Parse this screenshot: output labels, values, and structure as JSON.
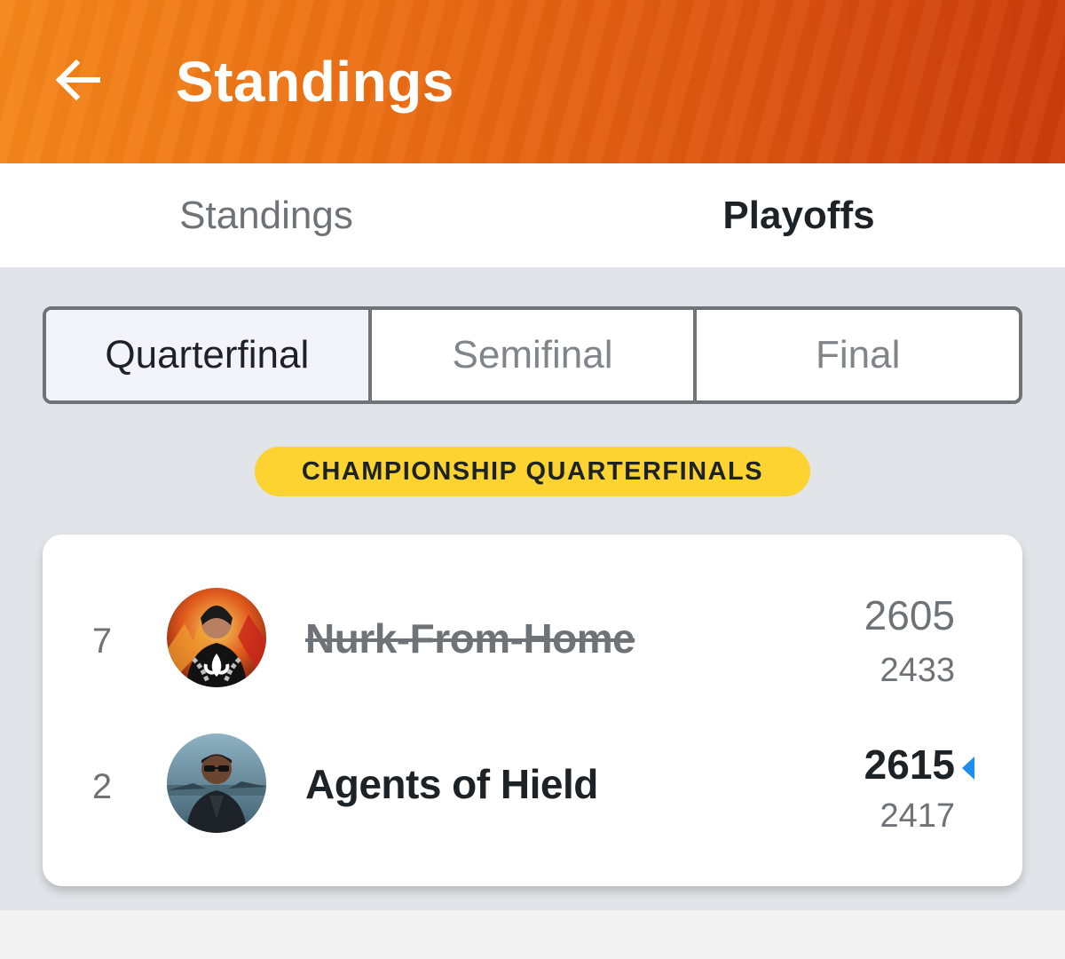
{
  "header": {
    "title": "Standings",
    "back_icon": "arrow-left-icon",
    "gradient_colors": [
      "#f5861a",
      "#cc3c0c"
    ]
  },
  "top_tabs": [
    {
      "label": "Standings",
      "active": false
    },
    {
      "label": "Playoffs",
      "active": true
    }
  ],
  "round_selector": {
    "options": [
      {
        "label": "Quarterfinal",
        "selected": true
      },
      {
        "label": "Semifinal",
        "selected": false
      },
      {
        "label": "Final",
        "selected": false
      }
    ]
  },
  "round_badge": {
    "label": "CHAMPIONSHIP QUARTERFINALS",
    "color": "#fcd331"
  },
  "matchup": {
    "teams": [
      {
        "seed": "7",
        "name": "Nurk-From-Home",
        "score": "2605",
        "projected": "2433",
        "eliminated": true,
        "winner": false
      },
      {
        "seed": "2",
        "name": "Agents of Hield",
        "score": "2615",
        "projected": "2417",
        "eliminated": false,
        "winner": true
      }
    ],
    "winner_marker_color": "#1e8cf0"
  }
}
